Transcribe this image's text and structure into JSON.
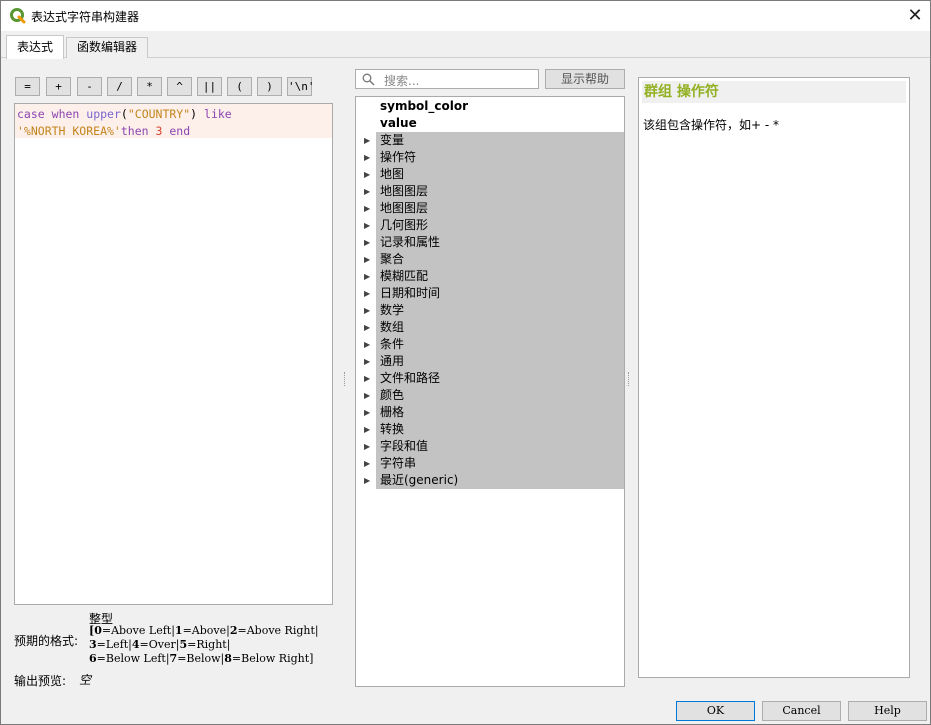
{
  "window": {
    "title": "表达式字符串构建器"
  },
  "tabs": [
    {
      "label": "表达式"
    },
    {
      "label": "函数编辑器"
    }
  ],
  "operators": [
    "=",
    "+",
    "-",
    "/",
    "*",
    "^",
    "||",
    "(",
    ")",
    "'\\n'"
  ],
  "editor": {
    "line1": {
      "kw1": "case",
      "kw2": "when",
      "fn": "upper",
      "lp": "(",
      "str1": "\"COUNTRY\"",
      "rp": ")",
      "kw3": "like"
    },
    "line2": {
      "str2": "'%NORTH KOREA%'",
      "kw4": "then",
      "num": "3",
      "kw5": "end"
    }
  },
  "search": {
    "placeholder": "搜索..."
  },
  "show_help_label": "显示帮助",
  "tree": {
    "plain_items": [
      "symbol_color",
      "value"
    ],
    "groups": [
      "变量",
      "操作符",
      "地图",
      "地图图层",
      "地图图层",
      "几何图形",
      "记录和属性",
      "聚合",
      "模糊匹配",
      "日期和时间",
      "数学",
      "数组",
      "条件",
      "通用",
      "文件和路径",
      "颜色",
      "栅格",
      "转换",
      "字段和值",
      "字符串",
      "最近(generic)"
    ]
  },
  "help": {
    "title": "群组 操作符",
    "description": "该组包含操作符，如+ - *"
  },
  "format": {
    "label": "预期的格式:",
    "type": "整型",
    "line1": [
      {
        "k": "[0",
        "v": "=Above Left|"
      },
      {
        "k": "1",
        "v": "=Above|"
      },
      {
        "k": "2",
        "v": "=Above Right|"
      }
    ],
    "line2": [
      {
        "k": "3",
        "v": "=Left|"
      },
      {
        "k": "4",
        "v": "=Over|"
      },
      {
        "k": "5",
        "v": "=Right|"
      }
    ],
    "line3": [
      {
        "k": "6",
        "v": "=Below Left|"
      },
      {
        "k": "7",
        "v": "=Below|"
      },
      {
        "k": "8",
        "v": "=Below Right]"
      }
    ]
  },
  "preview": {
    "label": "输出预览:",
    "value": "空"
  },
  "buttons": {
    "ok": "OK",
    "cancel": "Cancel",
    "help": "Help"
  }
}
